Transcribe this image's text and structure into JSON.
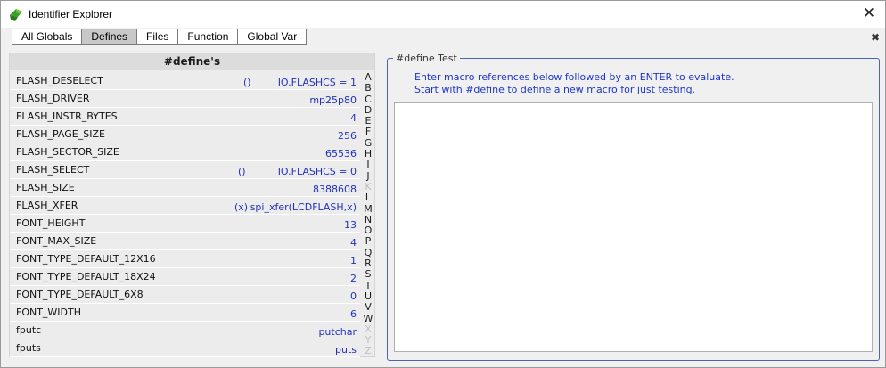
{
  "window": {
    "title": "Identifier Explorer"
  },
  "tabs": [
    "All Globals",
    "Defines",
    "Files",
    "Function",
    "Global Var"
  ],
  "active_tab": "Defines",
  "list": {
    "header": "#define's",
    "rows": [
      {
        "name": "FLASH_DESELECT",
        "args": "()",
        "value": "IO.FLASHCS = 1"
      },
      {
        "name": "FLASH_DRIVER",
        "args": "",
        "value": "mp25p80"
      },
      {
        "name": "FLASH_INSTR_BYTES",
        "args": "",
        "value": "4"
      },
      {
        "name": "FLASH_PAGE_SIZE",
        "args": "",
        "value": "256"
      },
      {
        "name": "FLASH_SECTOR_SIZE",
        "args": "",
        "value": "65536"
      },
      {
        "name": "FLASH_SELECT",
        "args": "()",
        "value": "IO.FLASHCS = 0"
      },
      {
        "name": "FLASH_SIZE",
        "args": "",
        "value": "8388608"
      },
      {
        "name": "FLASH_XFER",
        "args": "(x)",
        "value": "spi_xfer(LCDFLASH,x)"
      },
      {
        "name": "FONT_HEIGHT",
        "args": "",
        "value": "13"
      },
      {
        "name": "FONT_MAX_SIZE",
        "args": "",
        "value": "4"
      },
      {
        "name": "FONT_TYPE_DEFAULT_12X16",
        "args": "",
        "value": "1"
      },
      {
        "name": "FONT_TYPE_DEFAULT_18X24",
        "args": "",
        "value": "2"
      },
      {
        "name": "FONT_TYPE_DEFAULT_6X8",
        "args": "",
        "value": "0"
      },
      {
        "name": "FONT_WIDTH",
        "args": "",
        "value": "6"
      },
      {
        "name": "fputc",
        "args": "",
        "value": "putchar"
      },
      {
        "name": "fputs",
        "args": "",
        "value": "puts"
      }
    ]
  },
  "alphabet": [
    {
      "letter": "A",
      "enabled": true
    },
    {
      "letter": "B",
      "enabled": true
    },
    {
      "letter": "C",
      "enabled": true
    },
    {
      "letter": "D",
      "enabled": true
    },
    {
      "letter": "E",
      "enabled": true
    },
    {
      "letter": "F",
      "enabled": true
    },
    {
      "letter": "G",
      "enabled": true
    },
    {
      "letter": "H",
      "enabled": true
    },
    {
      "letter": "I",
      "enabled": true
    },
    {
      "letter": "J",
      "enabled": true
    },
    {
      "letter": "K",
      "enabled": false
    },
    {
      "letter": "L",
      "enabled": true
    },
    {
      "letter": "M",
      "enabled": true
    },
    {
      "letter": "N",
      "enabled": true
    },
    {
      "letter": "O",
      "enabled": true
    },
    {
      "letter": "P",
      "enabled": true
    },
    {
      "letter": "Q",
      "enabled": true
    },
    {
      "letter": "R",
      "enabled": true
    },
    {
      "letter": "S",
      "enabled": true
    },
    {
      "letter": "T",
      "enabled": true
    },
    {
      "letter": "U",
      "enabled": true
    },
    {
      "letter": "V",
      "enabled": true
    },
    {
      "letter": "W",
      "enabled": true
    },
    {
      "letter": "X",
      "enabled": false
    },
    {
      "letter": "Y",
      "enabled": false
    },
    {
      "letter": "Z",
      "enabled": false
    }
  ],
  "test_panel": {
    "title": "#define Test",
    "hint_line1": "Enter macro references below followed by an ENTER to evaluate.",
    "hint_line2": "Start with #define to define a new macro for just testing.",
    "input_value": ""
  },
  "colors": {
    "value_text": "#2233bb",
    "hint_text": "#1f36c8",
    "group_border": "#4a62b8",
    "app_icon_green": "#3aa02a"
  },
  "icons": {
    "app": "identifier-explorer-logo-icon",
    "close_window": "close-icon",
    "close_panel": "close-panel-icon"
  },
  "glyphs": {
    "close_window": "✕",
    "close_panel": "✖"
  }
}
